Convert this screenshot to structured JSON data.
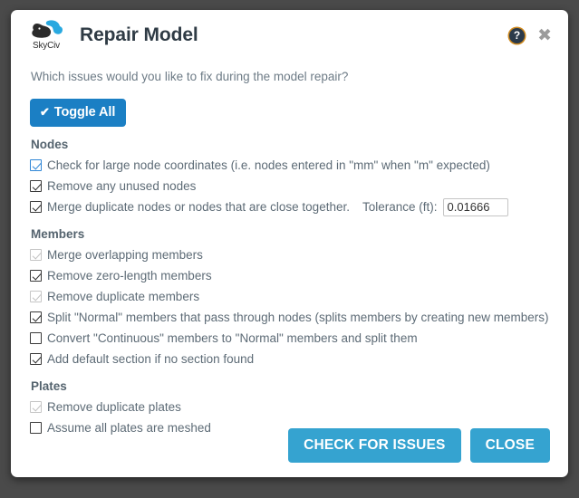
{
  "dialog": {
    "brand": "SkyCiv",
    "title": "Repair Model",
    "subtitle": "Which issues would you like to fix during the model repair?",
    "help_glyph": "?",
    "close_glyph": "✖",
    "toggle_all_label": "Toggle All",
    "toggle_all_glyph": "✔"
  },
  "sections": [
    {
      "title": "Nodes",
      "options": [
        {
          "label": "Check for large node coordinates (i.e. nodes entered in \"mm\" when \"m\" expected)",
          "checked": true,
          "disabled": false,
          "focused": true
        },
        {
          "label": "Remove any unused nodes",
          "checked": true,
          "disabled": false,
          "focused": false
        },
        {
          "label": "Merge duplicate nodes or nodes that are close together.",
          "checked": true,
          "disabled": false,
          "focused": false,
          "field": {
            "label": "Tolerance (ft):",
            "value": "0.01666"
          }
        }
      ]
    },
    {
      "title": "Members",
      "options": [
        {
          "label": "Merge overlapping members",
          "checked": true,
          "disabled": true,
          "focused": false
        },
        {
          "label": "Remove zero-length members",
          "checked": true,
          "disabled": false,
          "focused": false
        },
        {
          "label": "Remove duplicate members",
          "checked": true,
          "disabled": true,
          "focused": false
        },
        {
          "label": "Split \"Normal\" members that pass through nodes (splits members by creating new members)",
          "checked": true,
          "disabled": false,
          "focused": false
        },
        {
          "label": "Convert \"Continuous\" members to \"Normal\" members and split them",
          "checked": false,
          "disabled": false,
          "focused": false
        },
        {
          "label": "Add default section if no section found",
          "checked": true,
          "disabled": false,
          "focused": false
        }
      ]
    },
    {
      "title": "Plates",
      "options": [
        {
          "label": "Remove duplicate plates",
          "checked": true,
          "disabled": true,
          "focused": false
        },
        {
          "label": "Assume all plates are meshed",
          "checked": false,
          "disabled": false,
          "focused": false
        }
      ]
    }
  ],
  "footer": {
    "check_label": "CHECK FOR ISSUES",
    "close_label": "CLOSE"
  },
  "colors": {
    "backdrop": "#4a4a4a",
    "toggle_blue": "#1b7fc4",
    "button_blue": "#35a3d0",
    "focus_blue": "#2f86d6",
    "logo_blue": "#29a9e0",
    "logo_dark": "#2b2b2b",
    "help_ring": "#d08a1e"
  }
}
